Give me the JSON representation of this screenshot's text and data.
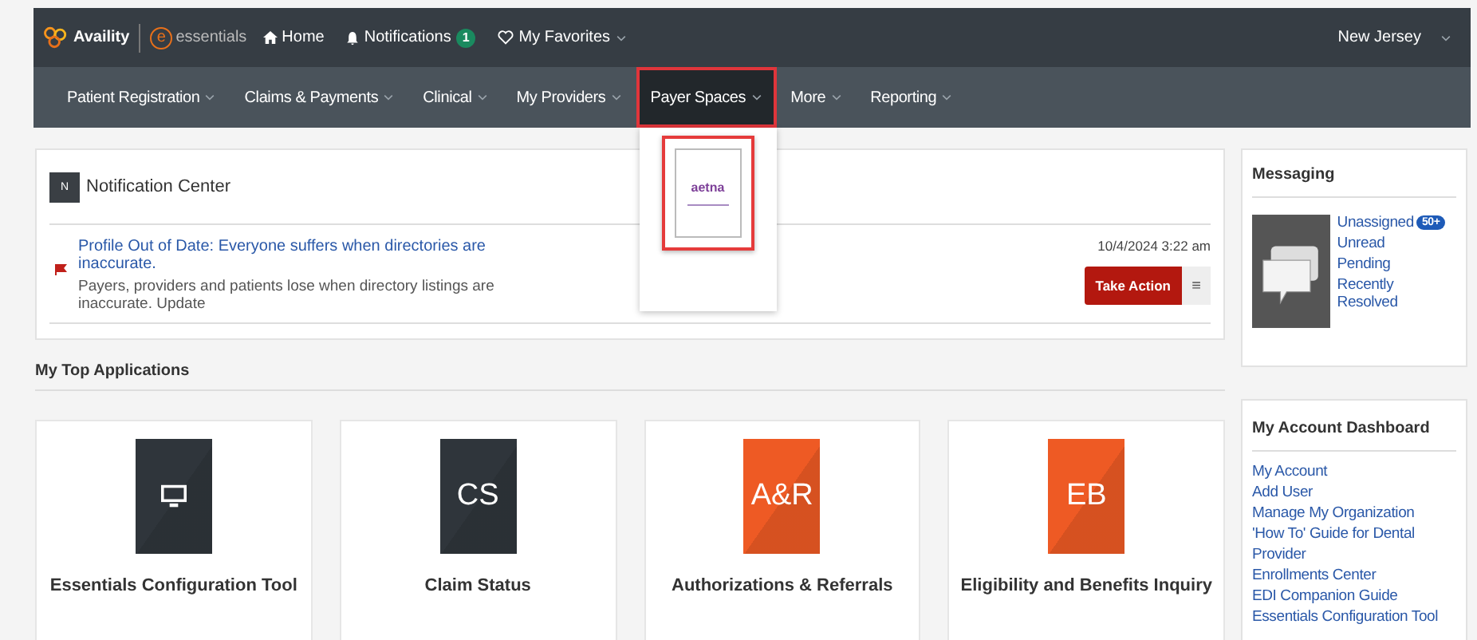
{
  "header": {
    "brand": "Availity",
    "product_mark": "e",
    "product": "essentials",
    "links": [
      {
        "label": "Home",
        "kind": "home"
      },
      {
        "label": "Notifications",
        "kind": "bell",
        "badge": "1"
      },
      {
        "label": "My Favorites",
        "kind": "heart",
        "dropdown": true
      }
    ],
    "region": "New Jersey"
  },
  "nav": [
    {
      "label": "Patient Registration",
      "selected": false
    },
    {
      "label": "Claims & Payments",
      "selected": false
    },
    {
      "label": "Clinical",
      "selected": false
    },
    {
      "label": "My Providers",
      "selected": false
    },
    {
      "label": "Payer Spaces",
      "selected": true
    },
    {
      "label": "More",
      "selected": false
    },
    {
      "label": "Reporting",
      "selected": false
    }
  ],
  "payer_menu": {
    "logo": "aetna"
  },
  "notification_center": {
    "icon_letter": "N",
    "title": "Notification Center",
    "items": [
      {
        "title": "Profile Out of Date: Everyone suffers when directories are inaccurate.",
        "body": "Payers, providers and patients lose when directory listings are inaccurate. Update",
        "date": "10/4/2024 3:22 am",
        "action": "Take Action",
        "menu_glyph": "≡"
      }
    ]
  },
  "top_apps": {
    "title": "My Top Applications",
    "apps": [
      {
        "name": "Essentials Configuration Tool",
        "kind": "monitor",
        "color": "#2f353b"
      },
      {
        "name": "Claim Status",
        "kind": "abbr",
        "abbr": "CS",
        "color": "#2f353b"
      },
      {
        "name": "Authorizations & Referrals",
        "kind": "abbr",
        "abbr": "A&R",
        "color": "#ee5a24"
      },
      {
        "name": "Eligibility and Benefits Inquiry",
        "kind": "abbr",
        "abbr": "EB",
        "color": "#ee5a24"
      }
    ]
  },
  "messaging": {
    "title": "Messaging",
    "links": [
      {
        "label": "Unassigned",
        "badge": "50+"
      },
      {
        "label": "Unread"
      },
      {
        "label": "Pending"
      },
      {
        "label": "Recently Resolved"
      }
    ]
  },
  "account": {
    "title": "My Account Dashboard",
    "links": [
      "My Account",
      "Add User",
      "Manage My Organization",
      "'How To' Guide for Dental Provider",
      "Enrollments Center",
      "EDI Companion Guide",
      "Essentials Configuration Tool"
    ]
  }
}
